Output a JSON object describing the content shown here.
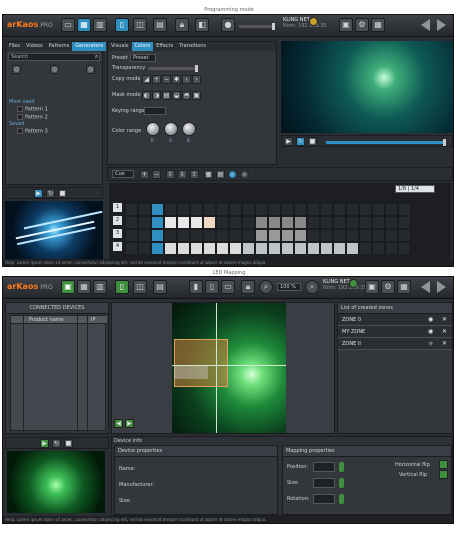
{
  "top": {
    "mode_title": "Programming mode",
    "logo": "arKaos",
    "logo_suffix": "PRO",
    "user_name": "KLING NET",
    "user_sub": "Nom: 192.168.35",
    "tabs_left": [
      "Files",
      "Videos",
      "Patterns",
      "Generators"
    ],
    "tabs_left_active": 3,
    "search_placeholder": "Search",
    "tree": {
      "cat1": "Most used",
      "items1": [
        "Pattern 1",
        "Pattern 2"
      ],
      "cat2": "Saved",
      "items2": [
        "Pattern 3"
      ]
    },
    "tabs_mid": [
      "Visuals",
      "Colors",
      "Effects",
      "Transitions"
    ],
    "tabs_mid_active": 1,
    "controls": {
      "preset_label": "Preset",
      "preset_value": "Preset",
      "transparency_label": "Transparency",
      "copy_mode_label": "Copy mode",
      "mask_mode_label": "Mask mode",
      "keying_range_label": "Keying range",
      "color_range_label": "Color range",
      "knob_labels": [
        "R",
        "G",
        "B"
      ]
    },
    "timeline": {
      "dropdown": "Cue",
      "header_value": "1/8 | 1/4",
      "row_numbers": [
        "1",
        "2",
        "3",
        "4"
      ]
    },
    "status": "Help: Lorem ipsum dolor sit amet, consectetur adipiscing elit, sed do eiusmod tempor incididunt ut labore et dolore magna aliqua."
  },
  "bottom": {
    "mode_title": "LED Mapping",
    "logo": "arKaos",
    "logo_suffix": "PRO",
    "zoom": "100 %",
    "user_name": "KLING NET",
    "user_sub": "Nom: 192.168.35",
    "devices_title": "CONNECTED DEVICES",
    "devices_columns": [
      "",
      "Product name",
      "",
      "IP"
    ],
    "zones_title": "List of created zones",
    "zones": [
      "ZONE 0",
      "MY ZONE",
      "ZONE II"
    ],
    "device_info": "Device info",
    "device_props": "Device properties",
    "device_fields": [
      "Name:",
      "Manufacturer:",
      "Size:"
    ],
    "mapping_props": "Mapping properties",
    "mapping_fields": [
      "Position:",
      "Size:",
      "Rotation:"
    ],
    "flip_labels": [
      "Horizontal flip",
      "Vertical flip"
    ],
    "status": "Help: Lorem ipsum dolor sit amet, consectetur adipiscing elit, sed do eiusmod tempor incididunt ut labore et dolore magna aliqua."
  },
  "colors": {
    "accent": "#2f8fc0",
    "logo": "#ff7a1a",
    "green": "#3e8f3e"
  }
}
